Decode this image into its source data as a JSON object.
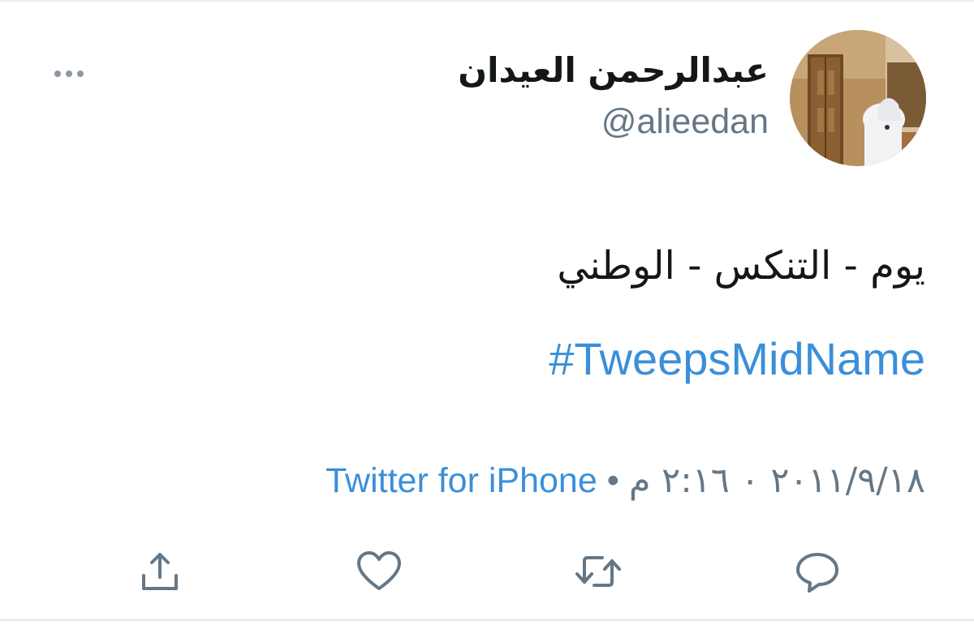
{
  "tweet": {
    "author": {
      "display_name": "عبدالرحمن العيدان",
      "handle": "@alieedan"
    },
    "text": "يوم - التنكس - الوطني",
    "hashtag": "#TweepsMidName",
    "meta": {
      "timestamp": "٢٠١١/٩/١٨ ٠ ٢:١٦ م",
      "separator": "•",
      "source": "Twitter for iPhone"
    },
    "actions": [
      "reply-icon",
      "retweet-icon",
      "like-icon",
      "share-icon"
    ]
  },
  "colors": {
    "link": "#3b8fd9",
    "secondary": "#657786",
    "icon": "#657786"
  }
}
